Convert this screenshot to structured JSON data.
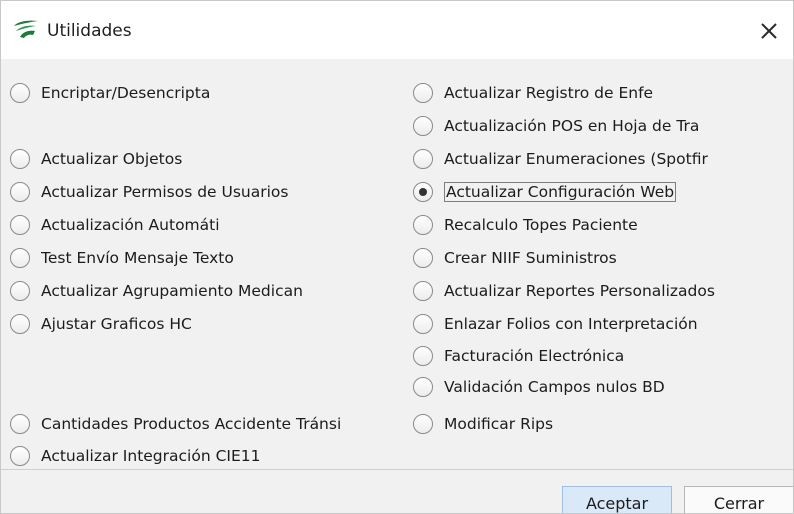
{
  "window": {
    "title": "Utilidades",
    "accent": "#d9e9f7",
    "logo_icon": "app-logo-icon",
    "close_icon": "close-icon"
  },
  "options_left": [
    {
      "label": "Encriptar/Desencripta",
      "selected": false
    },
    {
      "label": "Actualizar Objetos",
      "selected": false
    },
    {
      "label": "Actualizar Permisos de Usuarios",
      "selected": false
    },
    {
      "label": "Actualización Automáti",
      "selected": false
    },
    {
      "label": "Test Envío Mensaje Texto",
      "selected": false
    },
    {
      "label": "Actualizar Agrupamiento Medican",
      "selected": false
    },
    {
      "label": "Ajustar Graficos HC",
      "selected": false
    },
    {
      "label": "Cantidades Productos Accidente Tránsi",
      "selected": false
    },
    {
      "label": "Actualizar Integración CIE11",
      "selected": false
    }
  ],
  "options_right": [
    {
      "label": "Actualizar Registro de Enfe",
      "selected": false
    },
    {
      "label": "Actualización POS en Hoja de Tra",
      "selected": false
    },
    {
      "label": "Actualizar Enumeraciones (Spotfir",
      "selected": false
    },
    {
      "label": "Actualizar Configuración Web",
      "selected": true
    },
    {
      "label": "Recalculo Topes Paciente",
      "selected": false
    },
    {
      "label": "Crear NIIF Suministros",
      "selected": false
    },
    {
      "label": "Actualizar Reportes Personalizados",
      "selected": false
    },
    {
      "label": "Enlazar Folios con Interpretación",
      "selected": false
    },
    {
      "label": "Facturación Electrónica",
      "selected": false
    },
    {
      "label": "Validación Campos nulos BD",
      "selected": false
    },
    {
      "label": "Modificar Rips",
      "selected": false
    }
  ],
  "buttons": {
    "accept_label": "Aceptar",
    "close_label": "Cerrar"
  }
}
